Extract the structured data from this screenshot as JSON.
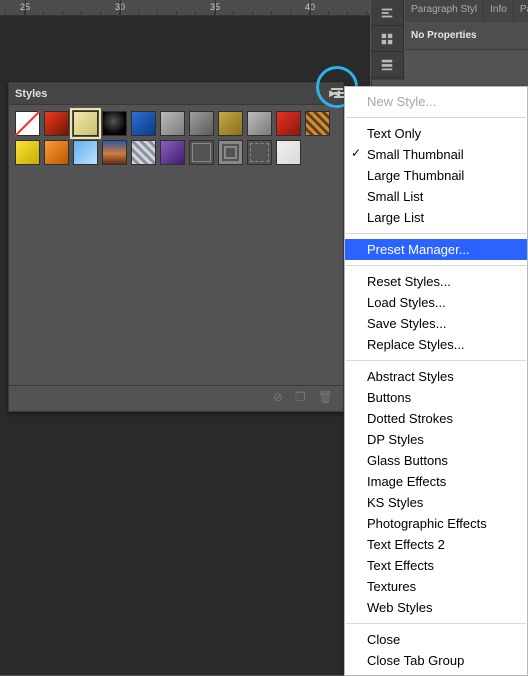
{
  "ruler": {
    "ticks": [
      "25",
      "30",
      "35",
      "40"
    ]
  },
  "right_panel": {
    "tabs": [
      "Paragraph Styl",
      "Info",
      "Paragra"
    ],
    "no_props": "No Properties"
  },
  "styles_panel": {
    "title": "Styles",
    "swatches": [
      {
        "c1": "#fff",
        "c2": "#ff2a2a",
        "type": "none"
      },
      {
        "c1": "#ee3a1f",
        "c2": "#6e1600"
      },
      {
        "c1": "#f0e8b4",
        "c2": "#cbbf6a",
        "selected": true
      },
      {
        "c1": "#2d2d2d",
        "c2": "#000",
        "type": "circle"
      },
      {
        "c1": "#2d6fd6",
        "c2": "#0b3a85"
      },
      {
        "c1": "#b8b8b8",
        "c2": "#7e7e7e"
      },
      {
        "c1": "#9e9e9e",
        "c2": "#5b5b5b"
      },
      {
        "c1": "#c6a646",
        "c2": "#8b6f1e"
      },
      {
        "c1": "#bdbdbd",
        "c2": "#787878"
      },
      {
        "c1": "#ea2f22",
        "c2": "#8a1911"
      },
      {
        "c1": "#d08a3d",
        "c2": "#5f3f17",
        "type": "pattern"
      },
      {
        "c1": "#f7e33a",
        "c2": "#c9ac00"
      },
      {
        "c1": "#ff9b3a",
        "c2": "#b95700"
      },
      {
        "c1": "#5db0f0",
        "c2": "#bfe3ff"
      },
      {
        "c1": "#3f73c9",
        "c2": "#f08a3d",
        "type": "sunset"
      },
      {
        "c1": "#cfd4da",
        "c2": "#89919c",
        "type": "pattern"
      },
      {
        "c1": "#8b5fc1",
        "c2": "#3f1d6d"
      },
      {
        "c1": "#7f7f7f",
        "c2": "#7f7f7f",
        "type": "outline"
      },
      {
        "c1": "#7f7f7f",
        "c2": "#7f7f7f",
        "type": "dbloutline"
      },
      {
        "c1": "#7f7f7f",
        "c2": "#7f7f7f",
        "type": "dashoutline"
      },
      {
        "c1": "#f0f0f0",
        "c2": "#d8d8d8"
      }
    ]
  },
  "context_menu": {
    "groups": [
      [
        {
          "label": "New Style...",
          "disabled": true
        }
      ],
      [
        {
          "label": "Text Only"
        },
        {
          "label": "Small Thumbnail",
          "checked": true
        },
        {
          "label": "Large Thumbnail"
        },
        {
          "label": "Small List"
        },
        {
          "label": "Large List"
        }
      ],
      [
        {
          "label": "Preset Manager...",
          "highlight": true
        }
      ],
      [
        {
          "label": "Reset Styles..."
        },
        {
          "label": "Load Styles..."
        },
        {
          "label": "Save Styles..."
        },
        {
          "label": "Replace Styles..."
        }
      ],
      [
        {
          "label": "Abstract Styles"
        },
        {
          "label": "Buttons"
        },
        {
          "label": "Dotted Strokes"
        },
        {
          "label": "DP Styles"
        },
        {
          "label": "Glass Buttons"
        },
        {
          "label": "Image Effects"
        },
        {
          "label": "KS Styles"
        },
        {
          "label": "Photographic Effects"
        },
        {
          "label": "Text Effects 2"
        },
        {
          "label": "Text Effects"
        },
        {
          "label": "Textures"
        },
        {
          "label": "Web Styles"
        }
      ],
      [
        {
          "label": "Close"
        },
        {
          "label": "Close Tab Group"
        }
      ]
    ]
  }
}
